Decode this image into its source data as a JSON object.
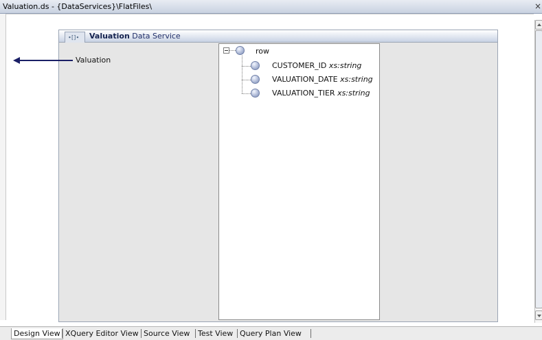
{
  "window": {
    "title": "Valuation.ds - {DataServices}\\FlatFiles\\",
    "close_glyph": "×"
  },
  "data_service": {
    "name": "Valuation",
    "suffix": "Data Service",
    "icon": "data-service-icon",
    "icon_glyph": "∙[]∙"
  },
  "source_label": "Valuation",
  "schema": {
    "root": {
      "label": "row",
      "expanded": true
    },
    "elements": [
      {
        "name": "CUSTOMER_ID",
        "type": "xs:string"
      },
      {
        "name": "VALUATION_DATE",
        "type": "xs:string"
      },
      {
        "name": "VALUATION_TIER",
        "type": "xs:string"
      }
    ]
  },
  "tabs": [
    {
      "label": "Design View",
      "active": true
    },
    {
      "label": "XQuery Editor View",
      "active": false
    },
    {
      "label": "Source View",
      "active": false
    },
    {
      "label": "Test View",
      "active": false
    },
    {
      "label": "Query Plan View",
      "active": false
    }
  ]
}
